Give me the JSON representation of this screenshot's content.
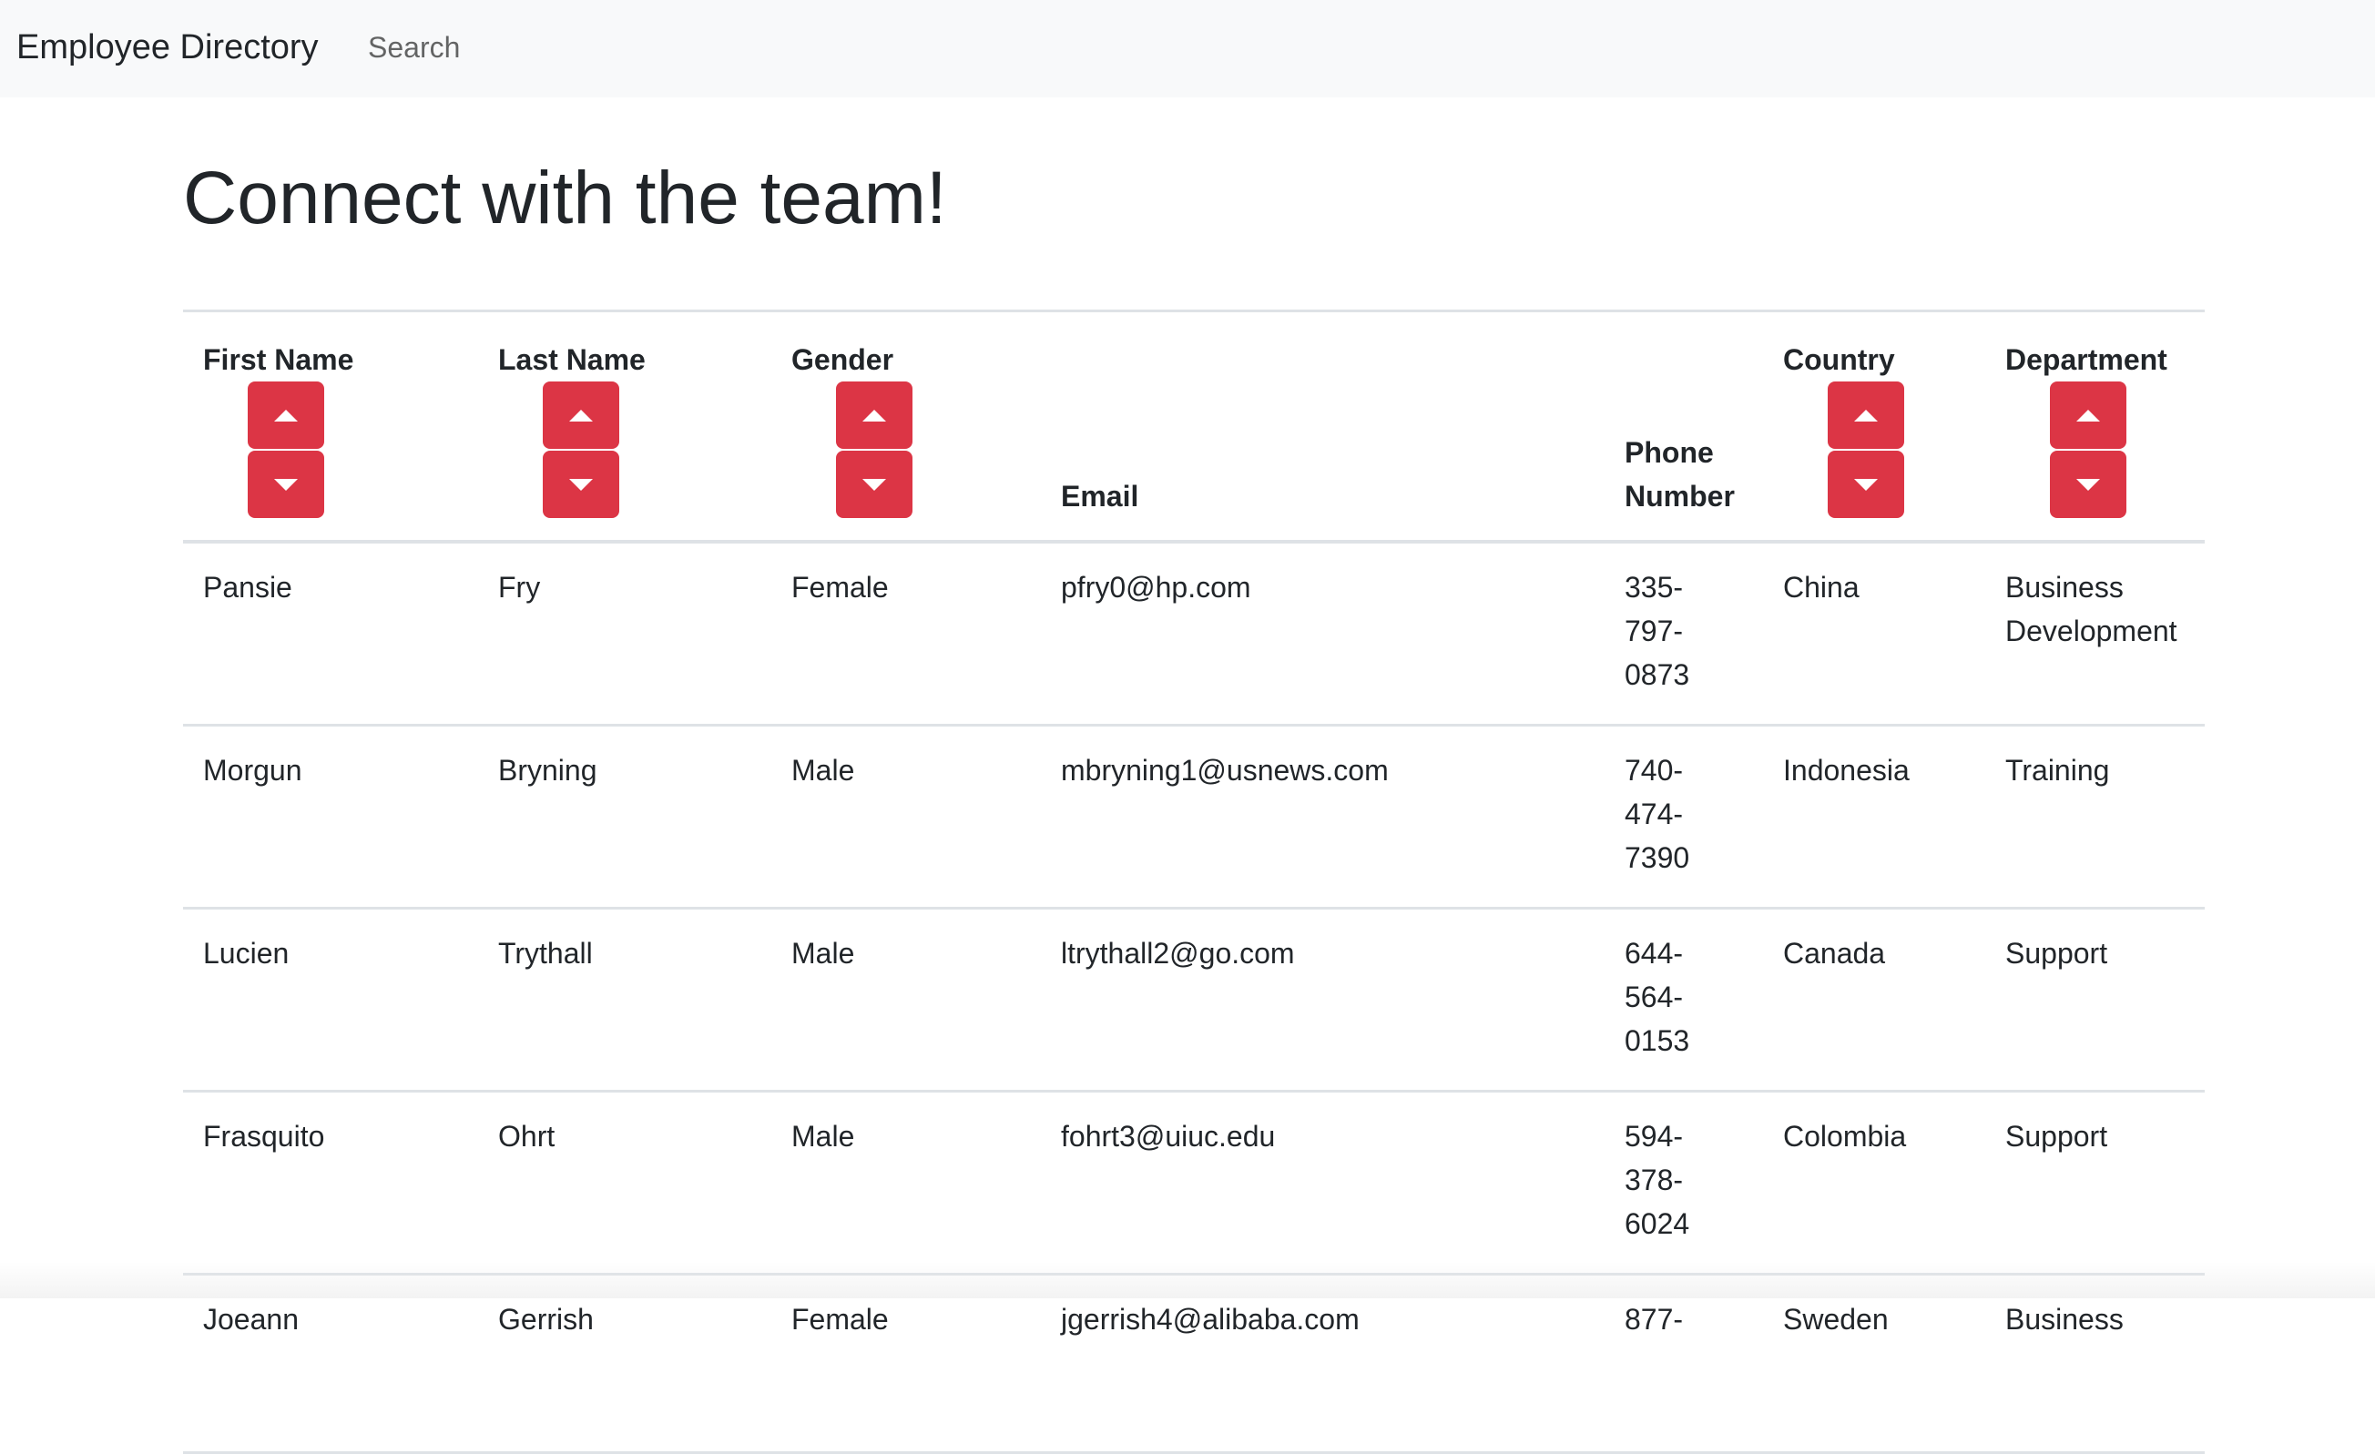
{
  "navbar": {
    "brand": "Employee Directory",
    "search_link": "Search"
  },
  "page_title": "Connect with the team!",
  "colors": {
    "sort_button": "#dc3545",
    "navbar_bg": "#f8f9fa",
    "divider": "#dee2e6"
  },
  "table": {
    "headers": {
      "first_name": "First Name",
      "last_name": "Last Name",
      "gender": "Gender",
      "email": "Email",
      "phone_line1": "Phone",
      "phone_line2": "Number",
      "country": "Country",
      "department": "Department"
    },
    "sort_icons": {
      "ascending": "caret-up-icon",
      "descending": "caret-down-icon"
    },
    "rows": [
      {
        "first": "Pansie",
        "last": "Fry",
        "gender": "Female",
        "email": "pfry0@hp.com",
        "phone": [
          "335-",
          "797-",
          "0873"
        ],
        "country": "China",
        "department": [
          "Business",
          "Development"
        ]
      },
      {
        "first": "Morgun",
        "last": "Bryning",
        "gender": "Male",
        "email": "mbryning1@usnews.com",
        "phone": [
          "740-",
          "474-",
          "7390"
        ],
        "country": "Indonesia",
        "department": [
          "Training",
          ""
        ]
      },
      {
        "first": "Lucien",
        "last": "Trythall",
        "gender": "Male",
        "email": "ltrythall2@go.com",
        "phone": [
          "644-",
          "564-",
          "0153"
        ],
        "country": "Canada",
        "department": [
          "Support",
          ""
        ]
      },
      {
        "first": "Frasquito",
        "last": "Ohrt",
        "gender": "Male",
        "email": "fohrt3@uiuc.edu",
        "phone": [
          "594-",
          "378-",
          "6024"
        ],
        "country": "Colombia",
        "department": [
          "Support",
          ""
        ]
      },
      {
        "first": "Joeann",
        "last": "Gerrish",
        "gender": "Female",
        "email": "jgerrish4@alibaba.com",
        "phone": [
          "877-",
          "",
          ""
        ],
        "country": "Sweden",
        "department": [
          "Business",
          ""
        ]
      }
    ]
  }
}
